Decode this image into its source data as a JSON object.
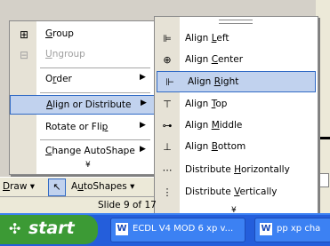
{
  "menu": {
    "items": [
      {
        "label": "Group",
        "icon": "group-icon",
        "disabled": false
      },
      {
        "label": "Ungroup",
        "icon": "ungroup-icon",
        "disabled": true
      },
      {
        "label": "Order",
        "submenu": true
      },
      {
        "label": "Align or Distribute",
        "submenu": true,
        "selected": true
      },
      {
        "label": "Rotate or Flip",
        "submenu": true
      },
      {
        "label": "Change AutoShape",
        "submenu": true
      }
    ],
    "more_glyph": "¥"
  },
  "submenu": {
    "items": [
      {
        "label": "Align Left",
        "icon": "align-left-icon"
      },
      {
        "label": "Align Center",
        "icon": "align-center-icon"
      },
      {
        "label": "Align Right",
        "icon": "align-right-icon",
        "selected": true
      },
      {
        "label": "Align Top",
        "icon": "align-top-icon"
      },
      {
        "label": "Align Middle",
        "icon": "align-middle-icon"
      },
      {
        "label": "Align Bottom",
        "icon": "align-bottom-icon"
      },
      {
        "label": "Distribute Horizontally",
        "icon": "distribute-horizontally-icon"
      },
      {
        "label": "Distribute Vertically",
        "icon": "distribute-vertically-icon"
      }
    ],
    "more_glyph": "¥"
  },
  "toolbar": {
    "draw_label": "Draw ▾",
    "autoshapes_label": "AutoShapes ▾"
  },
  "status": {
    "slide_text": "Slide 9 of 17"
  },
  "taskbar": {
    "start_label": "start",
    "tasks": [
      {
        "label": "ECDL V4 MOD 6 xp v...",
        "icon": "word-document-icon"
      },
      {
        "label": "pp xp cha",
        "icon": "word-document-icon"
      }
    ]
  },
  "colors": {
    "selection": "#c1d2ee",
    "selection_border": "#316ac5",
    "taskbar": "#245edb",
    "start": "#3c9a35"
  }
}
